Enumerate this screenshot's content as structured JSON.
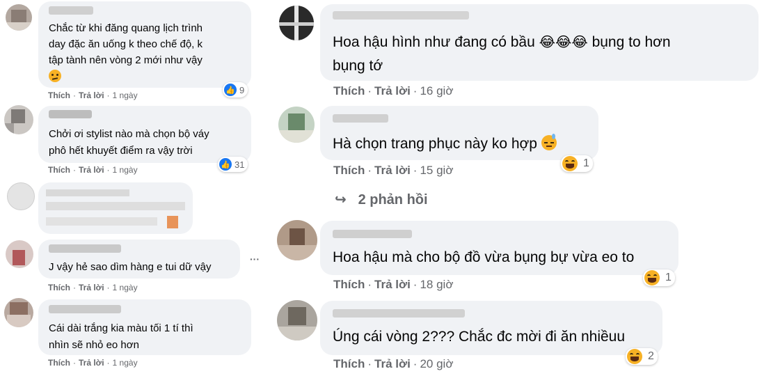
{
  "left_comments": [
    {
      "text": "Chắc từ khi đăng quang lịch trình\nday đặc ăn uống k theo chế độ, k\ntập tành nên vòng 2 mới như vậy",
      "like": "Thích",
      "reply": "Trả lời",
      "time": "1 ngày",
      "reaction_count": "9",
      "reaction_icon": "like-icon"
    },
    {
      "text": "Chởi ơi stylist nào mà chọn bộ váy\nphô hết khuyết điểm ra vậy trời",
      "like": "Thích",
      "reply": "Trả lời",
      "time": "1 ngày",
      "reaction_count": "31",
      "reaction_icon": "like-icon"
    },
    {
      "text": "J vậy hẻ sao dìm hàng e tui dữ vậy",
      "like": "Thích",
      "reply": "Trả lời",
      "time": "1 ngày",
      "more": "···"
    },
    {
      "text": "Cái dài trắng kia màu tối 1 tí thì\nnhìn sẽ nhỏ eo hơn",
      "like": "Thích",
      "reply": "Trả lời",
      "time": "1 ngày"
    }
  ],
  "right_comments": [
    {
      "text1": "Hoa hậu hình như đang có bầu ",
      "text2": " bụng to hơn\nbụng tớ",
      "emoji": "😂😂😂",
      "like": "Thích",
      "reply": "Trả lời",
      "time": "16 giờ"
    },
    {
      "text": "Hà chọn trang phục này ko hợp ",
      "like": "Thích",
      "reply": "Trả lời",
      "time": "15 giờ",
      "reaction_count": "1",
      "reaction_icon": "haha-icon"
    },
    {
      "text": "Hoa hậu mà cho bộ đồ vừa bụng bự vừa eo to",
      "like": "Thích",
      "reply": "Trả lời",
      "time": "18 giờ",
      "reaction_count": "1",
      "reaction_icon": "haha-icon"
    },
    {
      "text": "Úng cái vòng 2??? Chắc đc mời đi ăn nhiềuu",
      "like": "Thích",
      "reply": "Trả lời",
      "time": "20 giờ",
      "reaction_count": "2",
      "reaction_icon": "haha-icon"
    }
  ],
  "replies_link": "2 phản hồi",
  "colors": {
    "bubble": "#f0f2f5",
    "meta": "#65676b",
    "like_blue": "#1877f2",
    "haha_yellow": "#f7b125"
  }
}
